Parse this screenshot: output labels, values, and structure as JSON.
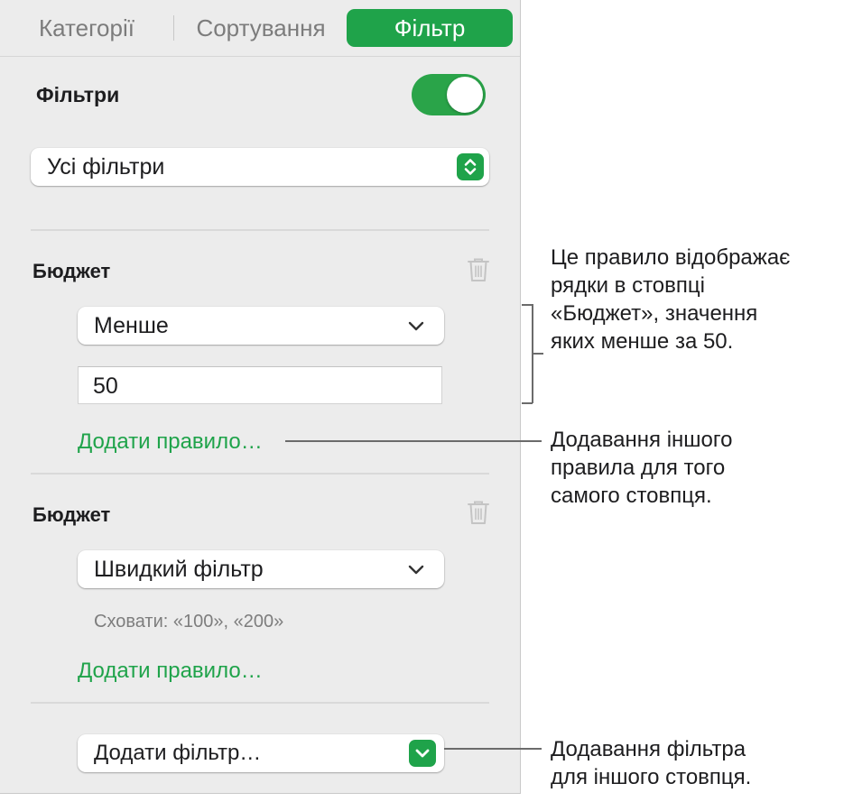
{
  "tabs": [
    {
      "label": "Категорії",
      "active": false
    },
    {
      "label": "Сортування",
      "active": false
    },
    {
      "label": "Фільтр",
      "active": true
    }
  ],
  "filters": {
    "label": "Фільтри",
    "toggle_on": true,
    "mode_selected": "Усі фільтри"
  },
  "rules": [
    {
      "column": "Бюджет",
      "condition": "Менше",
      "value": "50",
      "add_rule_label": "Додати правило…"
    },
    {
      "column": "Бюджет",
      "condition": "Швидкий фільтр",
      "hint": "Сховати: «100», «200»",
      "add_rule_label": "Додати правило…"
    }
  ],
  "add_filter_label": "Додати фільтр…",
  "callouts": {
    "rule": [
      "Це правило відображає",
      "рядки в стовпці",
      "«Бюджет», значення",
      "яких менше за 50."
    ],
    "add_rule": [
      "Додавання іншого",
      "правила для того",
      "самого стовпця."
    ],
    "add_filter": [
      "Додавання фільтра",
      "для іншого стовпця."
    ]
  },
  "colors": {
    "accent": "#1fa34a",
    "panel": "#ececec"
  },
  "icons": {
    "trash": "trash-icon",
    "stepper": "up-down-stepper-icon",
    "chevron": "chevron-down-icon"
  }
}
